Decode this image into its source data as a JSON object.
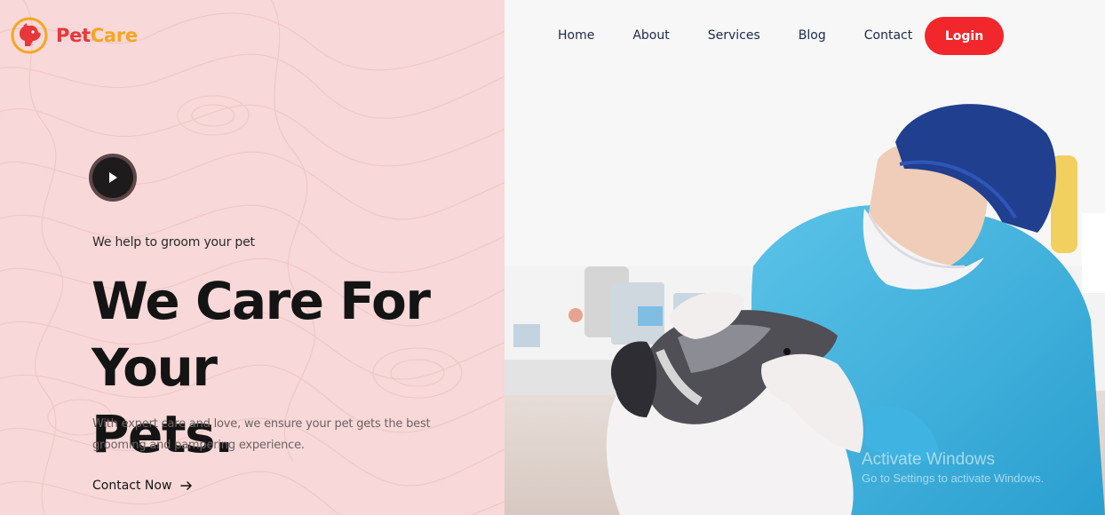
{
  "brand": {
    "name_part1": "Pet",
    "name_part2": "Care",
    "logo_icon": "dog-head-logo-icon"
  },
  "nav": {
    "items": [
      {
        "label": "Home"
      },
      {
        "label": "About"
      },
      {
        "label": "Services"
      },
      {
        "label": "Blog"
      },
      {
        "label": "Contact"
      }
    ],
    "login_label": "Login"
  },
  "hero": {
    "play_icon": "play-icon",
    "tagline": "We help to groom your pet",
    "title_line1": "We Care For Your",
    "title_line2": "Pets.",
    "description": "With expert care and love, we ensure your pet gets the best grooming and pampering experience.",
    "cta_label": "Contact Now",
    "cta_icon": "arrow-right-icon",
    "image_subject": "veterinarian examining a dog"
  },
  "watermark": {
    "line1": "Activate Windows",
    "line2": "Go to Settings to activate Windows."
  },
  "colors": {
    "accent_red": "#f2272b",
    "brand_red": "#e8373b",
    "brand_orange": "#f5a623",
    "hero_pink": "#f8d8d8",
    "nav_text": "#1c2a4a"
  }
}
